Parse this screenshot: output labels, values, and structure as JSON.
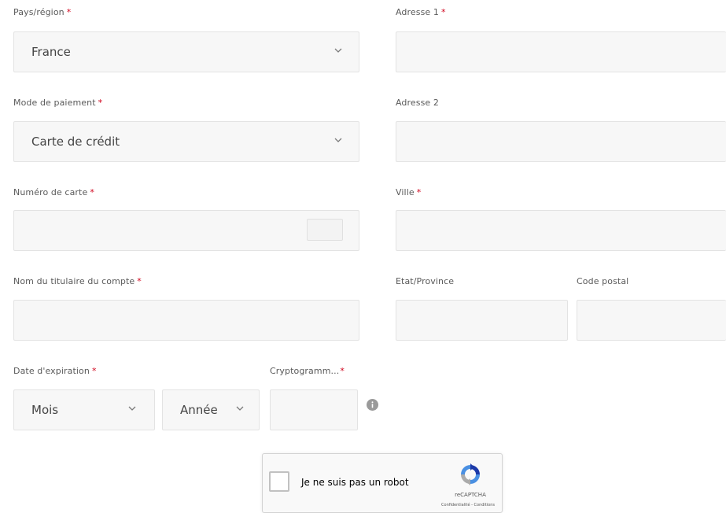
{
  "form": {
    "country": {
      "label": "Pays/région",
      "required": "*",
      "value": "France"
    },
    "payment_mode": {
      "label": "Mode de paiement",
      "required": "*",
      "value": "Carte de crédit"
    },
    "card_number": {
      "label": "Numéro de carte",
      "required": "*",
      "value": ""
    },
    "account_holder": {
      "label": "Nom du titulaire du compte",
      "required": "*",
      "value": ""
    },
    "expiration": {
      "label": "Date d'expiration",
      "required": "*",
      "month": "Mois",
      "year": "Année"
    },
    "cvv": {
      "label": "Cryptogramm...",
      "required": "*",
      "value": ""
    },
    "address1": {
      "label": "Adresse 1",
      "required": "*",
      "value": ""
    },
    "address2": {
      "label": "Adresse 2",
      "value": ""
    },
    "city": {
      "label": "Ville",
      "required": "*",
      "value": ""
    },
    "state": {
      "label": "Etat/Province",
      "value": ""
    },
    "postal_code": {
      "label": "Code postal",
      "value": ""
    }
  },
  "recaptcha": {
    "label": "Je ne suis pas un robot",
    "brand": "reCAPTCHA",
    "links": "Confidentialité - Conditions"
  },
  "colors": {
    "required": "#d0021b",
    "field_bg": "#f7f7f7",
    "field_border": "#e3e3e3"
  },
  "icons": {
    "chevron": "chevron-down-icon",
    "info": "info-icon",
    "card": "card-icon",
    "recaptcha": "recaptcha-logo-icon"
  }
}
